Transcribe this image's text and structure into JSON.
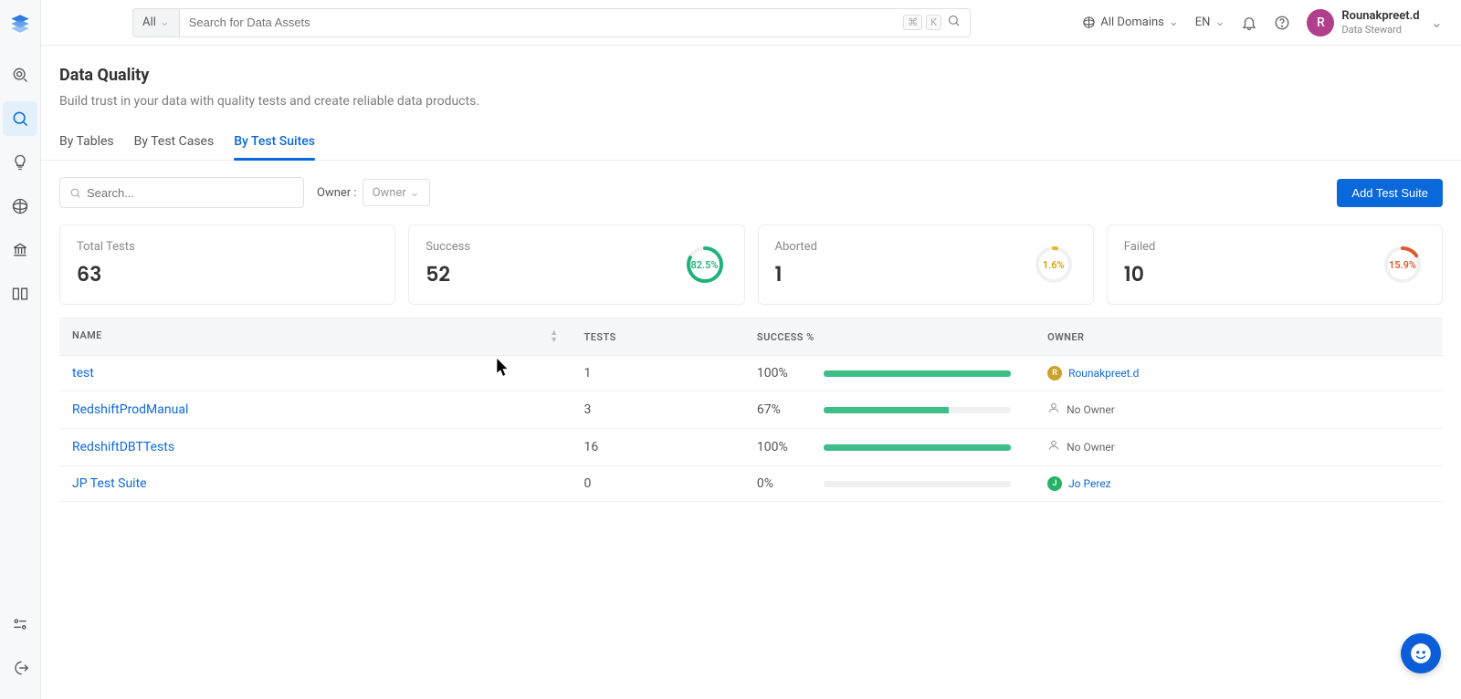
{
  "search": {
    "scope": "All",
    "placeholder": "Search for Data Assets",
    "kbd1": "⌘",
    "kbd2": "K"
  },
  "topbar": {
    "domains": "All Domains",
    "lang": "EN"
  },
  "user": {
    "initial": "R",
    "name": "Rounakpreet.d",
    "role": "Data Steward"
  },
  "page": {
    "title": "Data Quality",
    "subtitle": "Build trust in your data with quality tests and create reliable data products."
  },
  "tabs": [
    {
      "label": "By Tables"
    },
    {
      "label": "By Test Cases"
    },
    {
      "label": "By Test Suites",
      "active": true
    }
  ],
  "filter": {
    "search_placeholder": "Search...",
    "owner_label": "Owner :",
    "owner_selected": "Owner",
    "add_button": "Add Test Suite"
  },
  "stats": {
    "total": {
      "label": "Total Tests",
      "value": "63"
    },
    "success": {
      "label": "Success",
      "value": "52",
      "pct": "82.5%",
      "dash": 93
    },
    "aborted": {
      "label": "Aborted",
      "value": "1",
      "pct": "1.6%",
      "dash": 2
    },
    "failed": {
      "label": "Failed",
      "value": "10",
      "pct": "15.9%",
      "dash": 18
    }
  },
  "table": {
    "columns": {
      "name": "NAME",
      "tests": "TESTS",
      "success_pct": "SUCCESS %",
      "owner": "OWNER"
    },
    "rows": [
      {
        "name": "test",
        "tests": "1",
        "success_pct": "100%",
        "pct_num": 100,
        "owner_type": "user",
        "owner_name": "Rounakpreet.d",
        "owner_initial": "R",
        "avatar_class": "rk"
      },
      {
        "name": "RedshiftProdManual",
        "tests": "3",
        "success_pct": "67%",
        "pct_num": 67,
        "owner_type": "none",
        "owner_name": "No Owner"
      },
      {
        "name": "RedshiftDBTTests",
        "tests": "16",
        "success_pct": "100%",
        "pct_num": 100,
        "owner_type": "none",
        "owner_name": "No Owner"
      },
      {
        "name": "JP Test Suite",
        "tests": "0",
        "success_pct": "0%",
        "pct_num": 0,
        "owner_type": "user",
        "owner_name": "Jo Perez",
        "owner_initial": "J",
        "avatar_class": "jp"
      }
    ]
  }
}
